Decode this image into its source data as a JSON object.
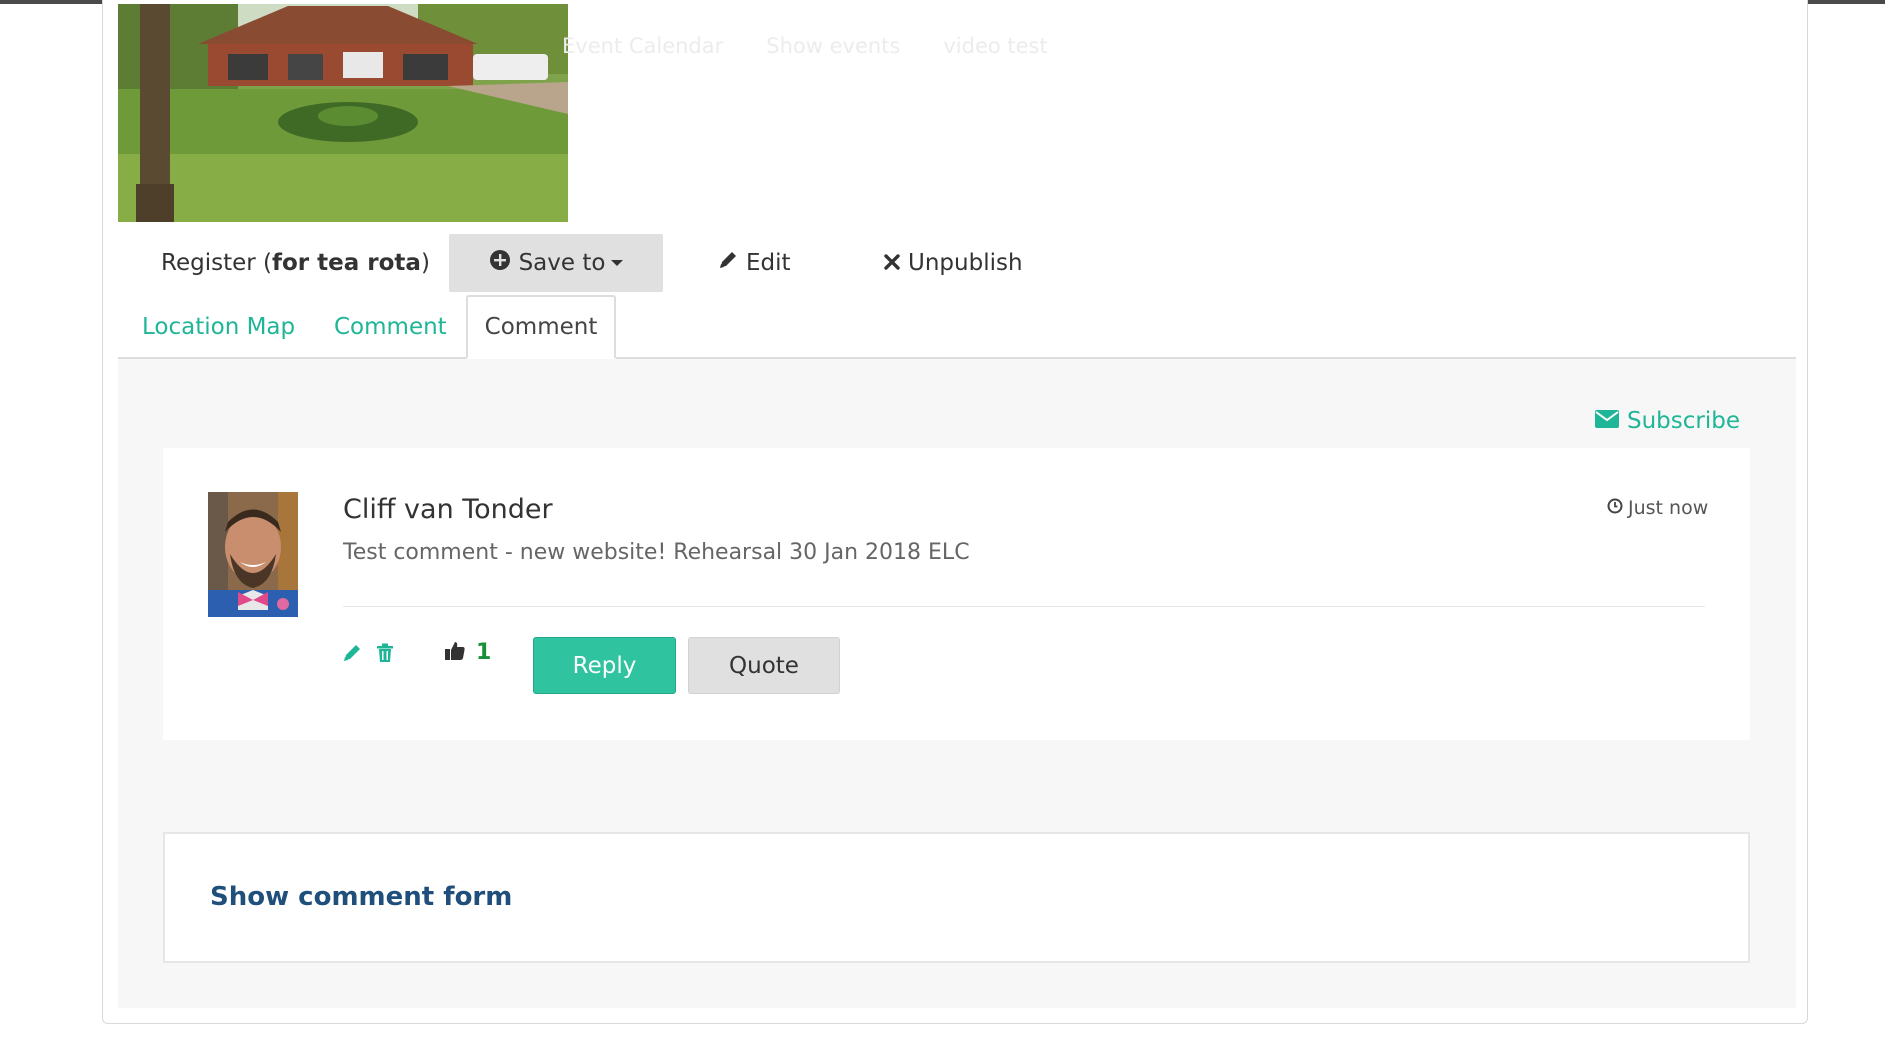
{
  "nav": {
    "items": [
      "Event Calendar",
      "Show events",
      "video test"
    ]
  },
  "actions": {
    "register_prefix": "Register (",
    "register_bold": "for tea rota",
    "register_suffix": ")",
    "save_to": "Save to",
    "edit": "Edit",
    "unpublish": "Unpublish"
  },
  "tabs": [
    {
      "label": "Location Map"
    },
    {
      "label": "Comment"
    },
    {
      "label": "Comment"
    }
  ],
  "subscribe": "Subscribe",
  "comment": {
    "author": "Cliff van Tonder",
    "text": "Test comment - new website! Rehearsal 30 Jan 2018 ELC",
    "timestamp": "Just now",
    "likes": "1",
    "reply": "Reply",
    "quote": "Quote"
  },
  "comment_form": {
    "toggle_label": "Show comment form"
  },
  "colors": {
    "accent": "#1fb597",
    "reply_button": "#2fc3a0",
    "link_dark": "#1f4f7a",
    "like_count": "#1a8f3a"
  }
}
